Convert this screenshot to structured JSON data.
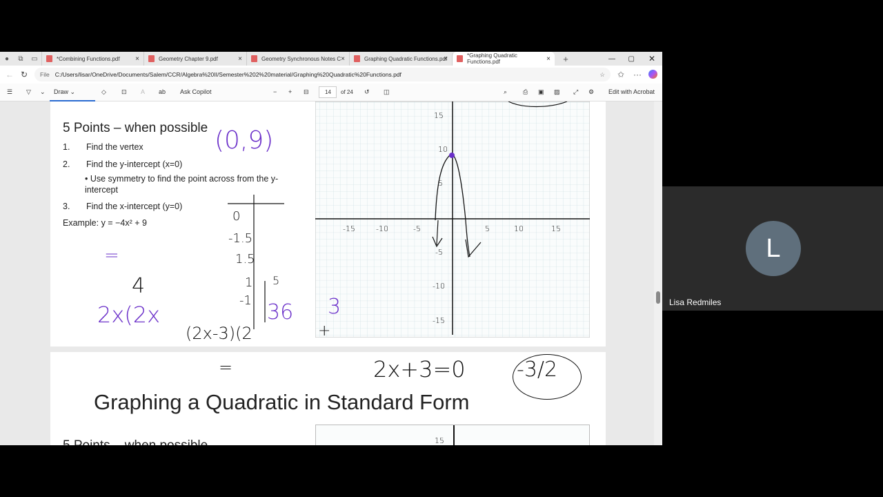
{
  "browser": {
    "tabs": [
      {
        "label": "*Combining Functions.pdf"
      },
      {
        "label": "Geometry Chapter 9.pdf"
      },
      {
        "label": "Geometry Synchronous Notes Ch"
      },
      {
        "label": "Graphing Quadratic Functions.pdf"
      },
      {
        "label": "*Graphing Quadratic Functions.pdf",
        "active": true
      }
    ],
    "new_tab": "+",
    "url_prefix": "File",
    "url": "C:/Users/lisar/OneDrive/Documents/Salem/CCR/Algebra%20II/Semester%202%20material/Graphing%20Quadratic%20Functions.pdf"
  },
  "pdf_toolbar": {
    "draw": "Draw",
    "ask_copilot": "Ask Copilot",
    "page": "14",
    "of_pages": "of 24",
    "edit_acrobat": "Edit with Acrobat"
  },
  "page1": {
    "title": "5 Points – when possible",
    "steps": [
      {
        "num": "1.",
        "text": "Find the vertex"
      },
      {
        "num": "2.",
        "text": "Find the y-intercept (x=0)"
      },
      {
        "num": "3.",
        "text": "Find the x-intercept (y=0)"
      }
    ],
    "bullet": "Use symmetry to find the point across from the y-intercept",
    "example": "Example: y = −4x² + 9",
    "graph": {
      "x_ticks": [
        "-15",
        "-10",
        "-5",
        "5",
        "10",
        "15"
      ],
      "y_ticks": [
        "15",
        "10",
        "5",
        "-5",
        "-10",
        "-15"
      ]
    },
    "handwriting": {
      "vertex": "(0,9)",
      "t1": "0",
      "t2": "-1.5",
      "t3": "1.5",
      "t4": "1",
      "t5": "5",
      "t6": "-1",
      "t7": "36",
      "three": "3",
      "eq1": "=",
      "four": "4",
      "expr1": "2x(2x",
      "expr2": "(2x-3)(2",
      "plus": "+",
      "eq2": "=",
      "solve": "2x+3=0",
      "answer": "-3/2"
    }
  },
  "page2": {
    "title": "Graphing a Quadratic in Standard Form",
    "subtitle": "5 Points – when possible",
    "y_tick": "15"
  },
  "participant": {
    "initial": "L",
    "name": "Lisa Redmiles"
  }
}
